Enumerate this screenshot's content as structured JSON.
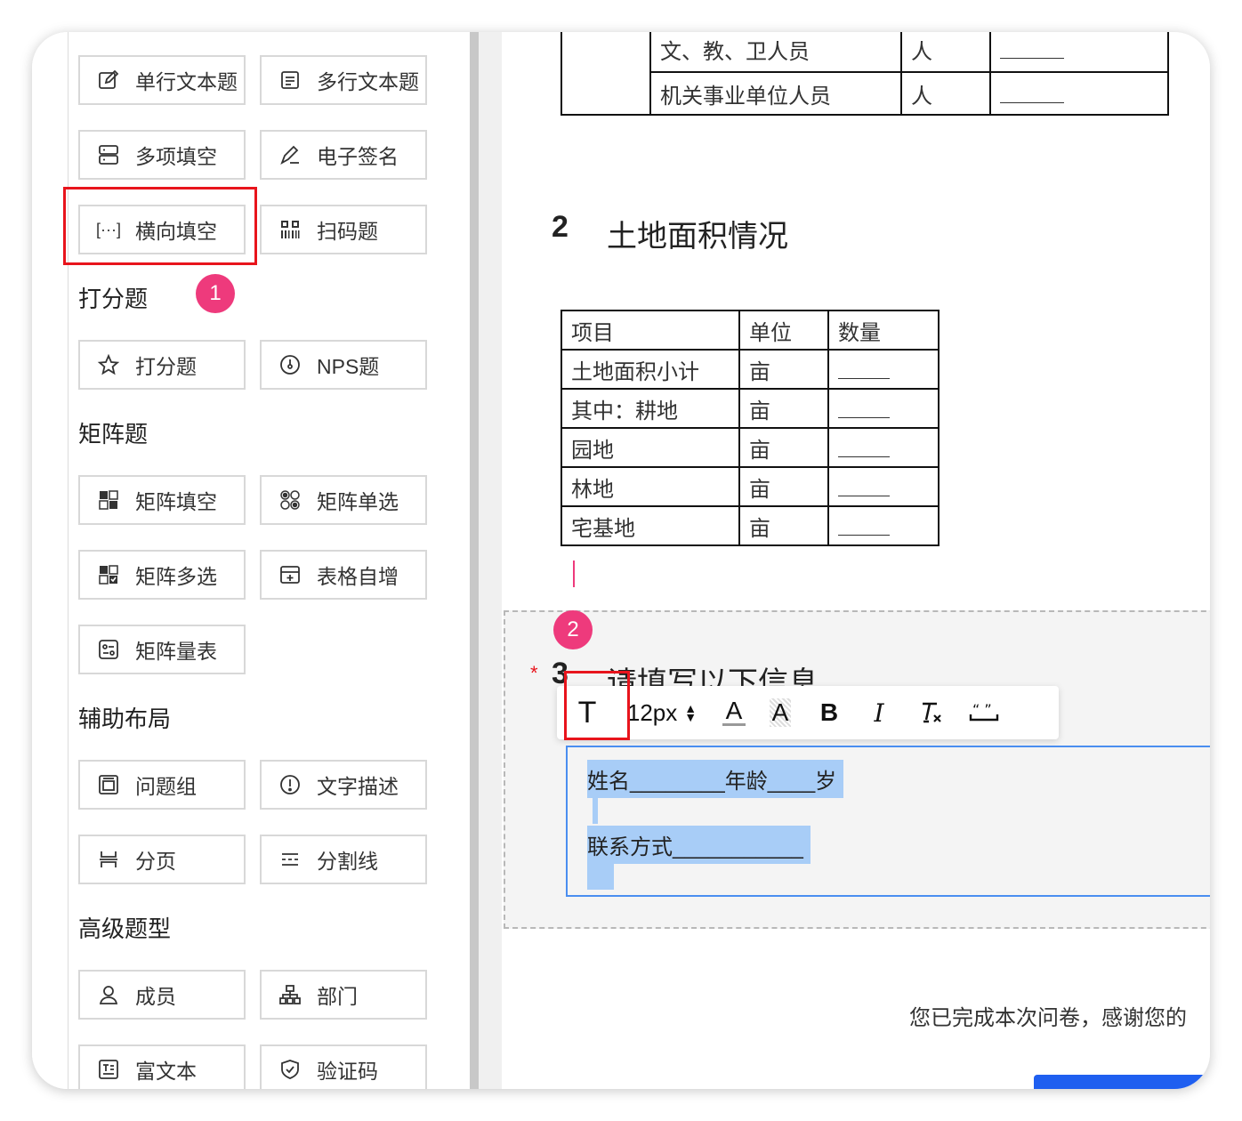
{
  "sidebar": {
    "buttons_top": [
      {
        "label": "单行文本题",
        "icon": "edit-icon"
      },
      {
        "label": "多行文本题",
        "icon": "multiline-icon"
      },
      {
        "label": "多项填空",
        "icon": "multi-fill-icon"
      },
      {
        "label": "电子签名",
        "icon": "signature-icon"
      },
      {
        "label": "横向填空",
        "icon": "bracket-icon"
      },
      {
        "label": "扫码题",
        "icon": "qrcode-icon"
      }
    ],
    "section_rating": "打分题",
    "rating_buttons": [
      {
        "label": "打分题",
        "icon": "star-icon"
      },
      {
        "label": "NPS题",
        "icon": "gauge-icon"
      }
    ],
    "section_matrix": "矩阵题",
    "matrix_buttons": [
      {
        "label": "矩阵填空",
        "icon": "matrix-fill-icon"
      },
      {
        "label": "矩阵单选",
        "icon": "matrix-radio-icon"
      },
      {
        "label": "矩阵多选",
        "icon": "matrix-check-icon"
      },
      {
        "label": "表格自增",
        "icon": "table-add-icon"
      },
      {
        "label": "矩阵量表",
        "icon": "matrix-scale-icon"
      }
    ],
    "section_layout": "辅助布局",
    "layout_buttons": [
      {
        "label": "问题组",
        "icon": "group-icon"
      },
      {
        "label": "文字描述",
        "icon": "info-icon"
      },
      {
        "label": "分页",
        "icon": "pagebreak-icon"
      },
      {
        "label": "分割线",
        "icon": "divider-icon"
      }
    ],
    "section_advanced": "高级题型",
    "advanced_buttons": [
      {
        "label": "成员",
        "icon": "person-icon"
      },
      {
        "label": "部门",
        "icon": "org-icon"
      },
      {
        "label": "富文本",
        "icon": "richtext-icon"
      },
      {
        "label": "验证码",
        "icon": "shield-icon"
      }
    ]
  },
  "annotations": {
    "badge1": "1",
    "badge2": "2",
    "accent": "#e8141c",
    "badge_color": "#ee3a7c"
  },
  "doc": {
    "top_table": [
      {
        "label": "文、教、卫人员",
        "unit": "人"
      },
      {
        "label": "机关事业单位人员",
        "unit": "人"
      }
    ],
    "q2_number": "2",
    "q2_title": "土地面积情况",
    "land_table": {
      "headers": [
        "项目",
        "单位",
        "数量"
      ],
      "rows": [
        {
          "item": "土地面积小计",
          "unit": "亩"
        },
        {
          "item": "其中：耕地",
          "unit": "亩"
        },
        {
          "item": "园地",
          "unit": "亩"
        },
        {
          "item": "林地",
          "unit": "亩"
        },
        {
          "item": "宅基地",
          "unit": "亩"
        }
      ]
    },
    "q3_required": "*",
    "q3_number": "3",
    "q3_title": "请填写以下信息",
    "toolbar": {
      "font_size": "12px",
      "text_label": "T",
      "bold": "B",
      "italic": "I"
    },
    "editor": {
      "line1": "姓名________年龄____岁",
      "line2": "联系方式___________"
    },
    "footer_text": "您已完成本次问卷，感谢您的"
  }
}
